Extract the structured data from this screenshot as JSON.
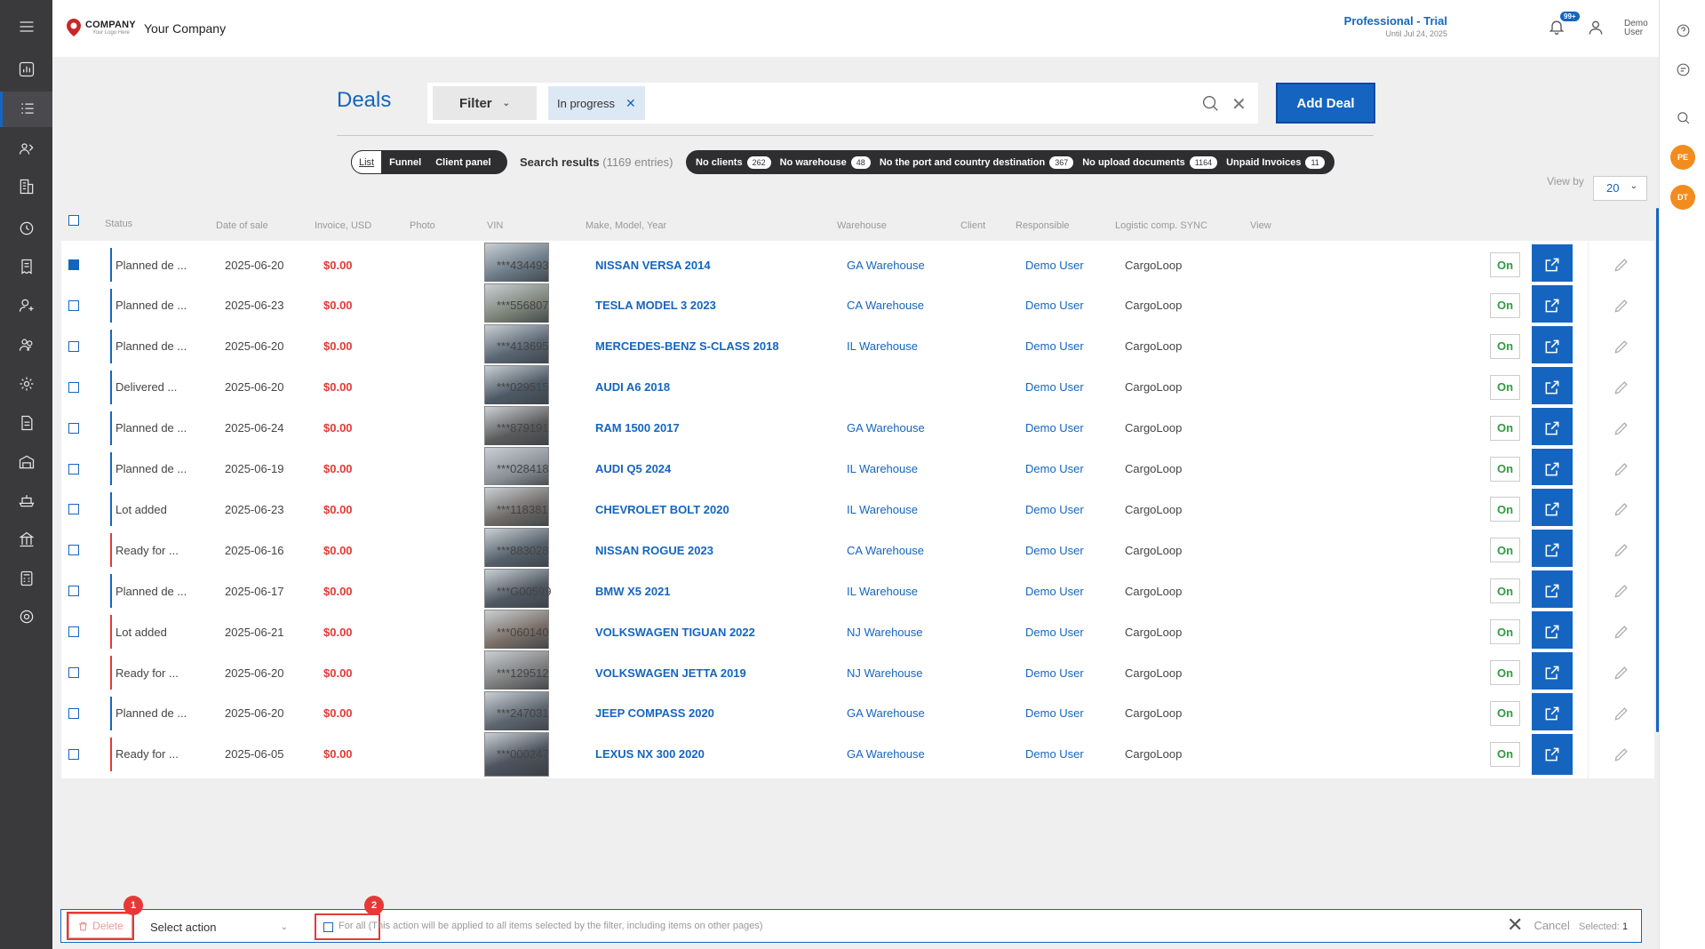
{
  "header": {
    "logo_main": "COMPANY",
    "logo_sub": "Your Logo Here",
    "company_name": "Your Company",
    "plan_title": "Professional - Trial",
    "plan_until": "Until Jul 24, 2025",
    "notif_badge": "99+",
    "user_name": "Demo User"
  },
  "right_rail": {
    "avatar1": "PE",
    "avatar2": "DT"
  },
  "toolbar": {
    "title": "Deals",
    "filter_label": "Filter",
    "chip_label": "In progress",
    "add_deal": "Add Deal"
  },
  "views": {
    "list": "List",
    "funnel": "Funnel",
    "client_panel": "Client panel"
  },
  "results": {
    "label": "Search results",
    "count": "(1169 entries)"
  },
  "pills": [
    {
      "label": "No clients",
      "count": "262"
    },
    {
      "label": "No warehouse",
      "count": "48"
    },
    {
      "label": "No the port and country destination",
      "count": "367"
    },
    {
      "label": "No upload documents",
      "count": "1164"
    },
    {
      "label": "Unpaid Invoices",
      "count": "11"
    }
  ],
  "viewby": {
    "label": "View by",
    "value": "20"
  },
  "columns": {
    "status": "Status",
    "date": "Date of sale",
    "invoice": "Invoice, USD",
    "photo": "Photo",
    "vin": "VIN",
    "make": "Make, Model, Year",
    "warehouse": "Warehouse",
    "client": "Client",
    "responsible": "Responsible",
    "logistic": "Logistic comp. SYNC",
    "view": "View"
  },
  "colors": {
    "accent": "#1565c0",
    "invoice": "#e53935",
    "on": "#2e9b3e",
    "status_blue": "#1565c0",
    "status_red": "#e53935"
  },
  "rows": [
    {
      "status": "Planned de ...",
      "status_color": "blue",
      "date": "2025-06-20",
      "invoice": "$0.00",
      "vin": "***434493",
      "make": "NISSAN VERSA 2014",
      "warehouse": "GA Warehouse",
      "responsible": "Demo User",
      "logistic": "CargoLoop",
      "sync": "On",
      "checked": true
    },
    {
      "status": "Planned de ...",
      "status_color": "blue",
      "date": "2025-06-23",
      "invoice": "$0.00",
      "vin": "***556807",
      "make": "TESLA MODEL 3 2023",
      "warehouse": "CA Warehouse",
      "responsible": "Demo User",
      "logistic": "CargoLoop",
      "sync": "On"
    },
    {
      "status": "Planned de ...",
      "status_color": "blue",
      "date": "2025-06-20",
      "invoice": "$0.00",
      "vin": "***413695",
      "make": "MERCEDES-BENZ S-CLASS 2018",
      "warehouse": "IL Warehouse",
      "responsible": "Demo User",
      "logistic": "CargoLoop",
      "sync": "On"
    },
    {
      "status": "Delivered ...",
      "status_color": "blue",
      "date": "2025-06-20",
      "invoice": "$0.00",
      "vin": "***029515",
      "make": "AUDI A6 2018",
      "warehouse": "",
      "responsible": "Demo User",
      "logistic": "CargoLoop",
      "sync": "On"
    },
    {
      "status": "Planned de ...",
      "status_color": "blue",
      "date": "2025-06-24",
      "invoice": "$0.00",
      "vin": "***879191",
      "make": "RAM 1500 2017",
      "warehouse": "GA Warehouse",
      "responsible": "Demo User",
      "logistic": "CargoLoop",
      "sync": "On"
    },
    {
      "status": "Planned de ...",
      "status_color": "blue",
      "date": "2025-06-19",
      "invoice": "$0.00",
      "vin": "***028418",
      "make": "AUDI Q5 2024",
      "warehouse": "IL Warehouse",
      "responsible": "Demo User",
      "logistic": "CargoLoop",
      "sync": "On"
    },
    {
      "status": "Lot added",
      "status_color": "blue",
      "date": "2025-06-23",
      "invoice": "$0.00",
      "vin": "***118381",
      "make": "CHEVROLET BOLT 2020",
      "warehouse": "IL Warehouse",
      "responsible": "Demo User",
      "logistic": "CargoLoop",
      "sync": "On"
    },
    {
      "status": "Ready for ...",
      "status_color": "red",
      "date": "2025-06-16",
      "invoice": "$0.00",
      "vin": "***883028",
      "make": "NISSAN ROGUE 2023",
      "warehouse": "CA Warehouse",
      "responsible": "Demo User",
      "logistic": "CargoLoop",
      "sync": "On"
    },
    {
      "status": "Planned de ...",
      "status_color": "blue",
      "date": "2025-06-17",
      "invoice": "$0.00",
      "vin": "***G00599",
      "make": "BMW X5 2021",
      "warehouse": "IL Warehouse",
      "responsible": "Demo User",
      "logistic": "CargoLoop",
      "sync": "On"
    },
    {
      "status": "Lot added",
      "status_color": "red",
      "date": "2025-06-21",
      "invoice": "$0.00",
      "vin": "***060140",
      "make": "VOLKSWAGEN TIGUAN 2022",
      "warehouse": "NJ Warehouse",
      "responsible": "Demo User",
      "logistic": "CargoLoop",
      "sync": "On"
    },
    {
      "status": "Ready for ...",
      "status_color": "red",
      "date": "2025-06-20",
      "invoice": "$0.00",
      "vin": "***129512",
      "make": "VOLKSWAGEN JETTA 2019",
      "warehouse": "NJ Warehouse",
      "responsible": "Demo User",
      "logistic": "CargoLoop",
      "sync": "On"
    },
    {
      "status": "Planned de ...",
      "status_color": "blue",
      "date": "2025-06-20",
      "invoice": "$0.00",
      "vin": "***247031",
      "make": "JEEP COMPASS 2020",
      "warehouse": "GA Warehouse",
      "responsible": "Demo User",
      "logistic": "CargoLoop",
      "sync": "On"
    },
    {
      "status": "Ready for ...",
      "status_color": "red",
      "date": "2025-06-05",
      "invoice": "$0.00",
      "vin": "***000247",
      "make": "LEXUS NX 300 2020",
      "warehouse": "GA Warehouse",
      "responsible": "Demo User",
      "logistic": "CargoLoop",
      "sync": "On"
    }
  ],
  "bottombar": {
    "delete": "Delete",
    "select_action": "Select action",
    "for_all": "For all",
    "for_all_note": "(This action will be applied to all items selected by the filter, including items on other pages)",
    "cancel": "Cancel",
    "selected_label": "Selected:",
    "selected_count": "1",
    "marker1": "1",
    "marker2": "2"
  },
  "icons": {
    "sidebar": [
      "menu-icon",
      "dashboard-icon",
      "deals-list-icon",
      "partners-icon",
      "company-icon",
      "sync-icon",
      "invoice-icon",
      "user-icon",
      "users-icon",
      "settings-gear-icon",
      "document-icon",
      "warehouse-icon",
      "ship-icon",
      "port-icon",
      "calculator-icon",
      "settings-icon"
    ],
    "right": [
      "help-icon",
      "chat-icon",
      "search-icon"
    ]
  }
}
